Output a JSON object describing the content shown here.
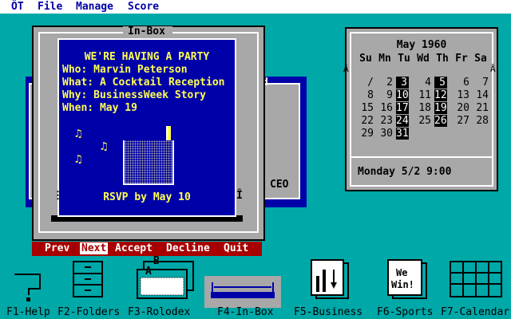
{
  "menu": {
    "logo": "ÔT",
    "items": [
      "File",
      "Manage",
      "Score"
    ]
  },
  "background_window": {
    "title_fragment": "d",
    "ceo_label": "CEO"
  },
  "inbox": {
    "title": "In-Box",
    "card": {
      "heading": "WE'RE HAVING A PARTY",
      "who": "Who: Marvin Peterson",
      "what": "What: A Cocktail Reception",
      "why": "Why: BusinessWeek Story",
      "when": "When: May 19",
      "rsvp": "RSVP by May 10"
    },
    "notes": [
      "♫",
      "♫",
      "♫"
    ]
  },
  "commands": {
    "prev": "Prev",
    "next": "Next",
    "accept": "Accept",
    "decline": "Decline",
    "quit": "Quit"
  },
  "calendar": {
    "month": "May 1960",
    "weekdays": [
      "Su",
      "Mn",
      "Tu",
      "Wd",
      "Th",
      "Fr",
      "Sa"
    ],
    "weeks": [
      [
        "/",
        "2",
        "3",
        "4",
        "5",
        "6",
        "7"
      ],
      [
        "8",
        "9",
        "10",
        "11",
        "12",
        "13",
        "14"
      ],
      [
        "15",
        "16",
        "17",
        "18",
        "19",
        "20",
        "21"
      ],
      [
        "22",
        "23",
        "24",
        "25",
        "26",
        "27",
        "28"
      ],
      [
        "29",
        "30",
        "31",
        "",
        "",
        "",
        ""
      ]
    ],
    "marked_days": [
      "3",
      "5",
      "10",
      "12",
      "17",
      "19",
      "24",
      "26",
      "31"
    ],
    "footer": "Monday 5/2 9:00"
  },
  "function_keys": [
    {
      "label": "F1-Help",
      "icon": "help-icon"
    },
    {
      "label": "F2-Folders",
      "icon": "file-cabinet-icon"
    },
    {
      "label": "F3-Rolodex",
      "icon": "rolodex-icon"
    },
    {
      "label": "F4-In-Box",
      "icon": "in-box-tray-icon"
    },
    {
      "label": "F5-Business",
      "icon": "business-chart-icon"
    },
    {
      "label": "F6-Sports",
      "icon": "sports-we-win-icon"
    },
    {
      "label": "F7-Calendar",
      "icon": "calendar-grid-icon"
    }
  ],
  "icon_text": {
    "rolodex_b": "B",
    "rolodex_a": "A",
    "sports_line1": "We",
    "sports_line2": "Win!"
  }
}
